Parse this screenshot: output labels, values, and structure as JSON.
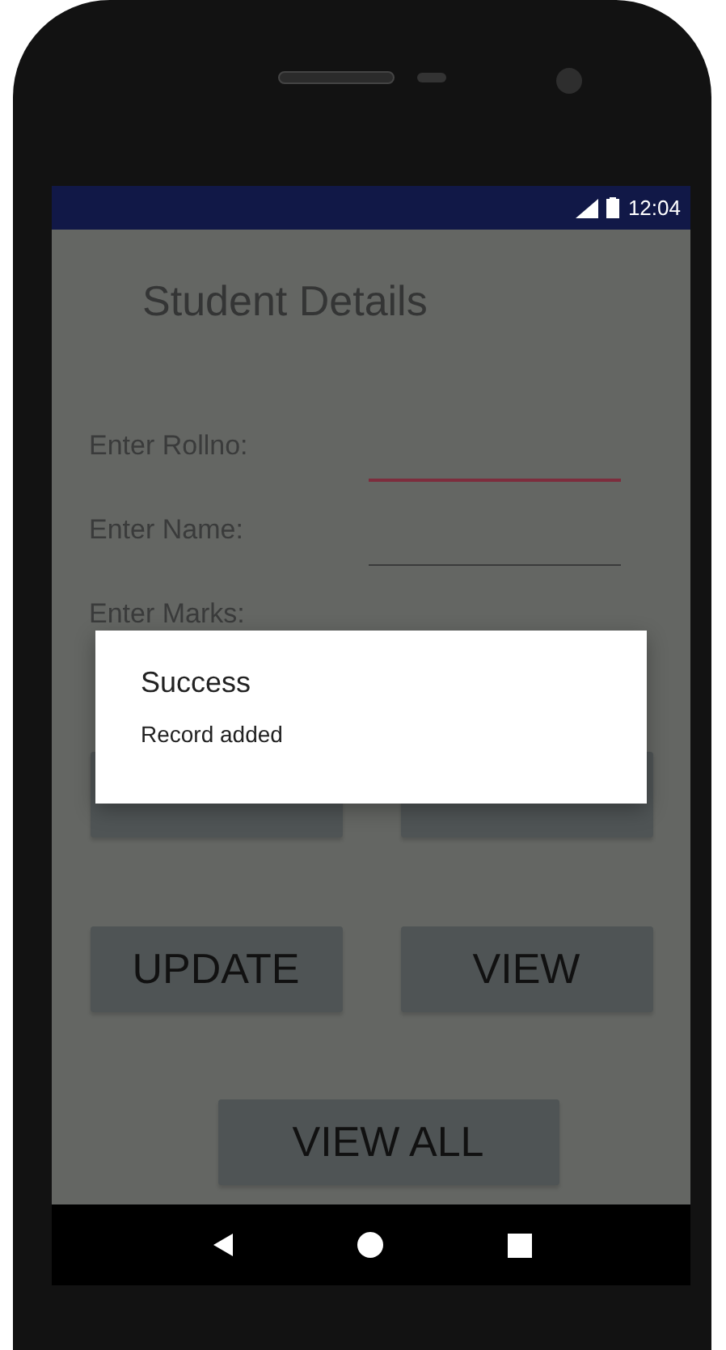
{
  "status_bar": {
    "time": "12:04"
  },
  "app": {
    "title": "Student Details",
    "fields": [
      {
        "label": "Enter Rollno:",
        "focused": true
      },
      {
        "label": "Enter Name:",
        "focused": false
      },
      {
        "label": "Enter Marks:"
      }
    ],
    "button_rows": [
      [
        {
          "kind": "covered"
        },
        {
          "kind": "covered"
        }
      ],
      [
        {
          "kind": "labeled",
          "label": "UPDATE"
        },
        {
          "kind": "labeled",
          "label": "VIEW"
        }
      ],
      [
        {
          "kind": "labeled",
          "label": "VIEW ALL"
        }
      ]
    ]
  },
  "dialog": {
    "title": "Success",
    "message": "Record added"
  },
  "nav_bar": {
    "buttons": [
      {
        "kind": "back"
      },
      {
        "kind": "home"
      },
      {
        "kind": "recents"
      }
    ]
  }
}
